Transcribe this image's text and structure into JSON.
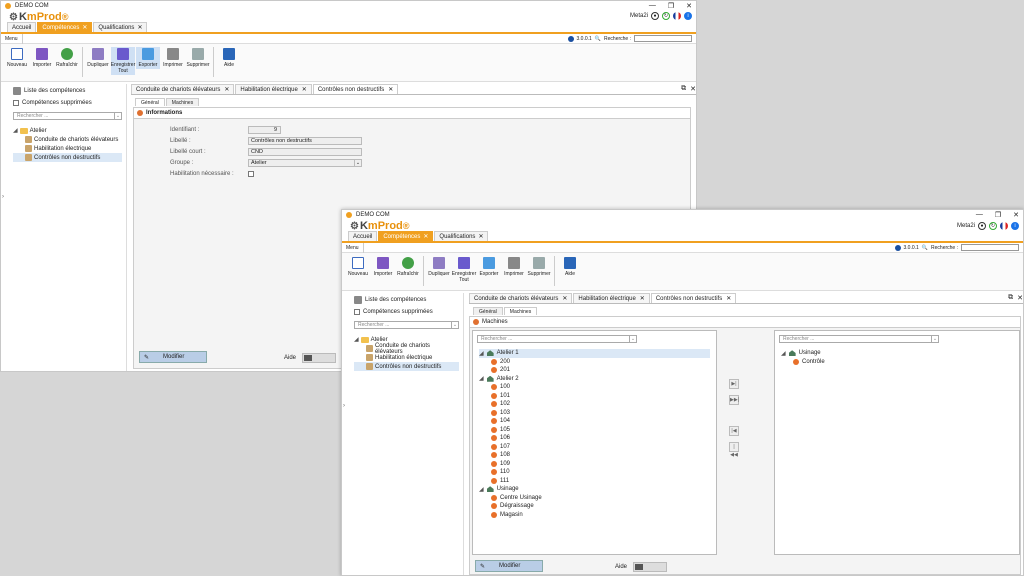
{
  "window": {
    "title": "DEMO COM",
    "controls": [
      "—",
      "❐",
      "✕"
    ]
  },
  "logo": {
    "k": "K",
    "rest": "mProd",
    "mark": "®"
  },
  "user": {
    "name": "Meta2i"
  },
  "doc_tabs": [
    {
      "label": "Accueil",
      "active": false,
      "closable": false
    },
    {
      "label": "Compétences",
      "active": true,
      "closable": true
    },
    {
      "label": "Qualifications",
      "active": false,
      "closable": true
    }
  ],
  "menu": {
    "tab": "Menu",
    "version": "3.0.0.1",
    "search_label": "Recherche :"
  },
  "ribbon": [
    {
      "label": "Nouveau",
      "icon": "new-icon",
      "cls": "new"
    },
    {
      "label": "Importer",
      "icon": "import-icon",
      "cls": "imp"
    },
    {
      "label": "Rafraîchir",
      "icon": "refresh-icon",
      "cls": "ref"
    },
    {
      "label": "Dupliquer",
      "icon": "duplicate-icon",
      "cls": "dup"
    },
    {
      "label": "Enregistrer Tout",
      "icon": "save-all-icon",
      "cls": "sav"
    },
    {
      "label": "Exporter",
      "icon": "export-icon",
      "cls": "exp"
    },
    {
      "label": "Imprimer",
      "icon": "print-icon",
      "cls": "prn"
    },
    {
      "label": "Supprimer",
      "icon": "delete-icon",
      "cls": "del"
    },
    {
      "label": "Aide",
      "icon": "help-icon",
      "cls": "hlp"
    }
  ],
  "left": {
    "title": "Liste des compétences",
    "deleted_label": "Compétences supprimées",
    "search_placeholder": "Rechercher ...",
    "tree_root": "Atelier",
    "tree_items": [
      "Conduite de chariots élévateurs",
      "Habilitation électrique",
      "Contrôles non destructifs"
    ]
  },
  "content_tabs": [
    {
      "label": "Conduite de chariots élévateurs"
    },
    {
      "label": "Habilitation électrique"
    },
    {
      "label": "Contrôles non destructifs"
    }
  ],
  "sub_tabs": [
    "Général",
    "Machines"
  ],
  "general": {
    "section": "Informations",
    "fields": [
      {
        "label": "Identifiant :",
        "value": "9"
      },
      {
        "label": "Libellé :",
        "value": "Contrôles non destructifs"
      },
      {
        "label": "Libellé court :",
        "value": "CND"
      },
      {
        "label": "Groupe :",
        "value": "Atelier"
      },
      {
        "label": "Habilitation nécessaire :",
        "value": ""
      }
    ]
  },
  "machines": {
    "section": "Machines",
    "search_placeholder": "Rechercher ...",
    "groups": [
      {
        "name": "Atelier 1",
        "items": [
          "200",
          "201"
        ]
      },
      {
        "name": "Atelier 2",
        "items": [
          "100",
          "101",
          "102",
          "103",
          "104",
          "105",
          "106",
          "107",
          "108",
          "109",
          "110",
          "111"
        ]
      },
      {
        "name": "Usinage",
        "items": [
          "Centre Usinage",
          "Dégraissage",
          "Magasin"
        ]
      }
    ],
    "assigned": [
      {
        "name": "Usinage",
        "items": [
          "Contrôle"
        ]
      }
    ],
    "transfer_buttons": [
      "▶|",
      "▶▶|",
      "|◀",
      "|◀◀"
    ]
  },
  "actions": {
    "modify": "Modifier",
    "help": "Aide"
  }
}
